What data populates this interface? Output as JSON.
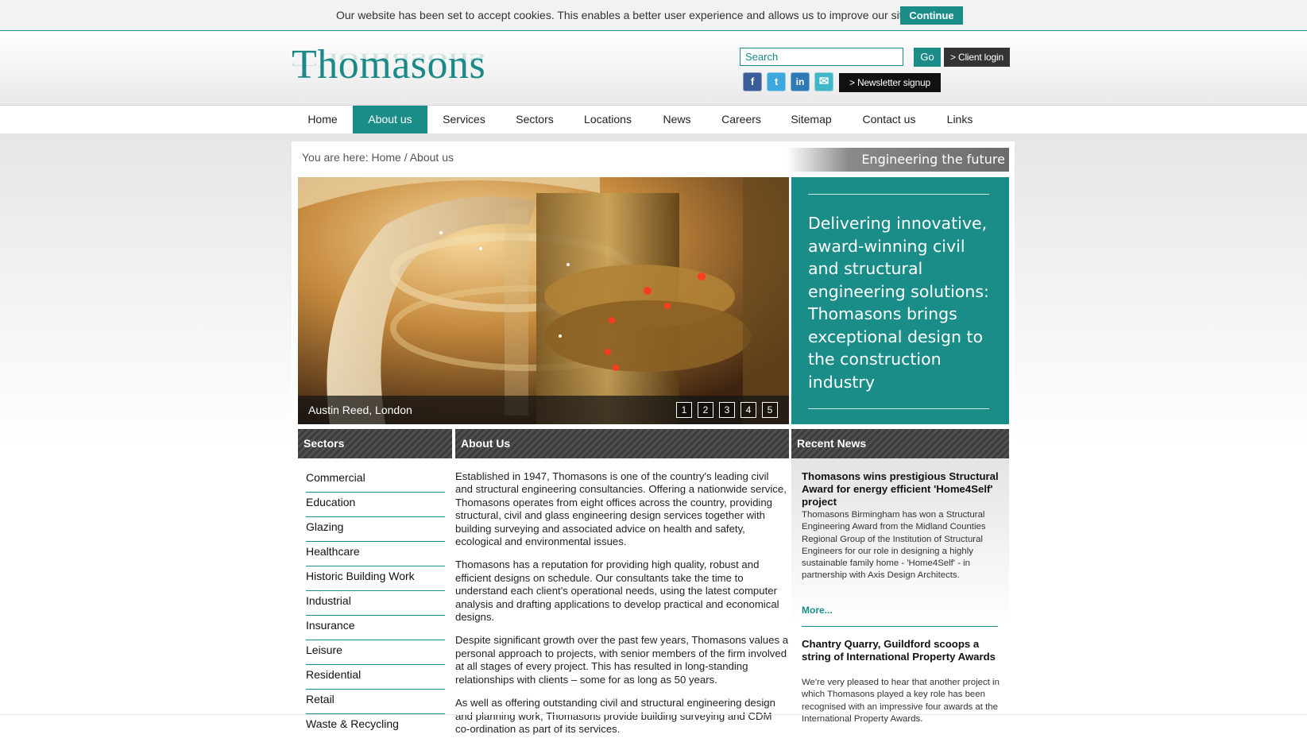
{
  "cookie": {
    "message": "Our website has been set to accept cookies. This enables a better user experience and allows us to improve our site",
    "continue_label": "Continue"
  },
  "header": {
    "logo_text": "Thomasons",
    "search_placeholder": "Search",
    "go_label": "Go",
    "client_login_label": "> Client login",
    "social": [
      {
        "icon": "facebook-icon",
        "glyph": "f",
        "color": "#3b5d9a"
      },
      {
        "icon": "twitter-icon",
        "glyph": "t",
        "color": "#3ba9dd"
      },
      {
        "icon": "linkedin-icon",
        "glyph": "in",
        "color": "#2f79b4"
      },
      {
        "icon": "email-icon",
        "glyph": "✉",
        "color": "#40b6c6"
      }
    ],
    "newsletter_label": "> Newsletter signup"
  },
  "nav": {
    "items": [
      "Home",
      "About us",
      "Services",
      "Sectors",
      "Locations",
      "News",
      "Careers",
      "Sitemap",
      "Contact us",
      "Links"
    ],
    "active": "About us"
  },
  "breadcrumb": {
    "prefix": "You are here: ",
    "home": "Home",
    "separator": " / ",
    "current": "About us"
  },
  "tagline": "Engineering the future",
  "hero": {
    "caption": "Austin Reed, London",
    "slides": [
      "1",
      "2",
      "3",
      "4",
      "5"
    ]
  },
  "intro_text": "Delivering innovative, award-winning civil and structural engineering solutions: Thomasons brings exceptional design to the construction industry",
  "sectors": {
    "heading": "Sectors",
    "items": [
      "Commercial",
      "Education",
      "Glazing",
      "Healthcare",
      "Historic Building Work",
      "Industrial",
      "Insurance",
      "Leisure",
      "Residential",
      "Retail",
      "Waste & Recycling"
    ]
  },
  "about": {
    "heading": "About Us",
    "paragraphs": [
      "Established in 1947, Thomasons is one of the country's leading civil and structural engineering consultancies. Offering a nationwide service, Thomasons operates from eight offices across the country, providing structural, civil and glass engineering design services together with building surveying and associated advice on health and safety, ecological and environmental issues.",
      "Thomasons has a reputation for providing high quality, robust and efficient designs on schedule. Our consultants take the time to understand each client's operational needs, using the latest computer analysis and drafting applications to develop practical and economical designs.",
      "Despite significant growth over the past few years, Thomasons values a personal approach to projects, with senior members of the firm involved at all stages of every project. This has resulted in long-standing relationships with clients – some for as long as 50 years.",
      "As well as offering outstanding civil and structural engineering design and planning work, Thomasons provide building surveying and CDM co-ordination as part of its services."
    ]
  },
  "news": {
    "heading": "Recent News",
    "items": [
      {
        "title": "Thomasons wins prestigious Structural Award for energy efficient 'Home4Self' project",
        "body": "Thomasons Birmingham has won a Structural Engineering Award from the Midland Counties Regional Group of the Institution of Structural Engineers for our role in designing a highly sustainable family home - 'Home4Self' - in partnership with Axis Design Architects.",
        "more": "More..."
      },
      {
        "title": "Chantry Quarry, Guildford scoops a string of International Property Awards",
        "body": "We're very pleased to hear that another project in which Thomasons played a key role has been recognised with an impressive four awards at the International Property Awards."
      }
    ]
  }
}
